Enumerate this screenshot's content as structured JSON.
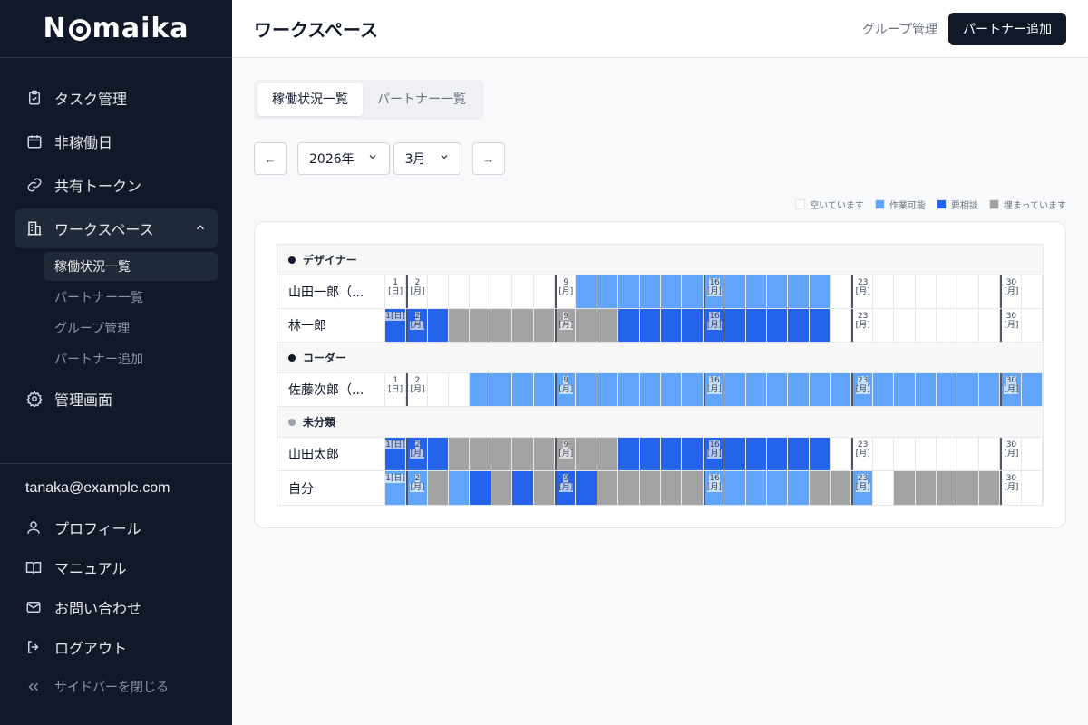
{
  "app": {
    "logo": "Nomaika"
  },
  "sidebar": {
    "items": [
      {
        "label": "タスク管理",
        "icon": "clipboard-icon"
      },
      {
        "label": "非稼働日",
        "icon": "calendar-icon"
      },
      {
        "label": "共有トークン",
        "icon": "link-icon"
      },
      {
        "label": "ワークスペース",
        "icon": "building-icon"
      },
      {
        "label": "管理画面",
        "icon": "gear-icon"
      }
    ],
    "subitems": [
      "稼働状況一覧",
      "パートナー一覧",
      "グループ管理",
      "パートナー追加"
    ],
    "email": "tanaka@example.com",
    "bottom": [
      {
        "label": "プロフィール",
        "icon": "user-icon"
      },
      {
        "label": "マニュアル",
        "icon": "book-icon"
      },
      {
        "label": "お問い合わせ",
        "icon": "mail-icon"
      },
      {
        "label": "ログアウト",
        "icon": "logout-icon"
      }
    ],
    "collapse_label": "サイドバーを閉じる"
  },
  "header": {
    "title": "ワークスペース",
    "group_link": "グループ管理",
    "add_button": "パートナー追加"
  },
  "tabs": [
    "稼働状況一覧",
    "パートナー一覧"
  ],
  "controls": {
    "prev": "←",
    "next": "→",
    "year": "2026年",
    "month": "3月"
  },
  "legend": [
    {
      "label": "空いています",
      "color": "#ffffff"
    },
    {
      "label": "作業可能",
      "color": "#60a5fa"
    },
    {
      "label": "要相談",
      "color": "#2563eb"
    },
    {
      "label": "埋まっています",
      "color": "#a3a3a3"
    }
  ],
  "calendar": {
    "days": 31,
    "labels": {
      "1": [
        "1",
        "[日]"
      ],
      "2": [
        "2",
        "[月]"
      ],
      "9": [
        "9",
        "[月]"
      ],
      "16": [
        "16",
        "[月]"
      ],
      "23": [
        "23",
        "[月]"
      ],
      "30": [
        "30",
        "[月]"
      ]
    },
    "week_starts": [
      2,
      9,
      16,
      23,
      30
    ],
    "groups": [
      {
        "name": "デザイナー",
        "dot_color": "#111827",
        "rows": [
          {
            "name": "山田一郎（...",
            "status": "WWWWWWWWWAAAAAAAAAAAAWWWWWWWWWW"
          },
          {
            "name": "林一郎",
            "status": "BBBFFFFFFFFBBBBBBBBBBWWWWWWWWWW"
          }
        ]
      },
      {
        "name": "コーダー",
        "dot_color": "#111827",
        "rows": [
          {
            "name": "佐藤次郎（...",
            "status": "WWWWAAAAAAAAAAAAAAAAAAAAAAAAAAA"
          }
        ]
      },
      {
        "name": "未分類",
        "dot_color": "#9ca3af",
        "rows": [
          {
            "name": "山田太郎",
            "status": "BBBFFFFFFFFBBBBBBBBBBWWWWWWWWWW"
          },
          {
            "name": "自分",
            "status": "AAFABFBFBBFFFFFAAAAAFFAWFFFFFWW"
          }
        ]
      }
    ]
  }
}
